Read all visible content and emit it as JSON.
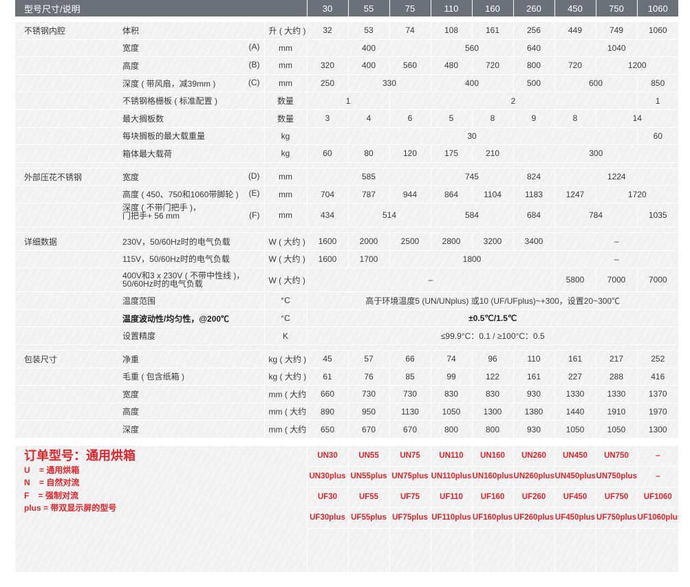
{
  "header": {
    "title": "型号尺寸/说明",
    "models": [
      "30",
      "55",
      "75",
      "110",
      "160",
      "260",
      "450",
      "750",
      "1060"
    ]
  },
  "chamber": {
    "section": "不锈钢内腔",
    "volume": {
      "label": "体积",
      "unit": "升 ( 大约 )",
      "values": [
        "32",
        "53",
        "74",
        "108",
        "161",
        "256",
        "449",
        "749",
        "1060"
      ]
    },
    "width": {
      "label": "宽度",
      "tag": "(A)",
      "unit": "mm",
      "v1": "400",
      "v2": "560",
      "v3": "640",
      "v4": "1040"
    },
    "height": {
      "label": "高度",
      "tag": "(B)",
      "unit": "mm",
      "values": [
        "320",
        "400",
        "560",
        "480",
        "720",
        "800",
        "720"
      ],
      "v8": "1200"
    },
    "depth": {
      "label": "深度 ( 带风扇，减39mm )",
      "tag": "(C)",
      "unit": "mm",
      "v1": "250",
      "v2": "330",
      "v3": "400",
      "v4": "500",
      "v5": "600",
      "v6": "850"
    },
    "grids": {
      "label": "不锈钢格栅板 ( 标准配置 )",
      "unit": "数量",
      "v1": "1",
      "v2": "2",
      "v3": "1"
    },
    "shelves": {
      "label": "最大搁板数",
      "unit": "数量",
      "values": [
        "3",
        "4",
        "6",
        "5",
        "8",
        "9",
        "8"
      ],
      "v8": "14"
    },
    "shelf_load": {
      "label": "每块搁板的最大载重量",
      "unit": "kg",
      "v1": "30",
      "v2": "60"
    },
    "total_load": {
      "label": "箱体最大载荷",
      "unit": "kg",
      "values": [
        "60",
        "80",
        "120",
        "175",
        "210"
      ],
      "v6": "300"
    }
  },
  "exterior": {
    "section": "外部压花不锈钢",
    "width": {
      "label": "宽度",
      "tag": "(D)",
      "unit": "mm",
      "v1": "585",
      "v2": "745",
      "v3": "824",
      "v4": "1224"
    },
    "height": {
      "label": "高度 ( 450、750和1060带脚轮 )",
      "tag": "(E)",
      "unit": "mm",
      "values": [
        "704",
        "787",
        "944",
        "864",
        "1104",
        "1183",
        "1247"
      ],
      "v8": "1720"
    },
    "depth": {
      "label": "深度 ( 不带门把手 )，\n门把手+ 56 mm",
      "tag": "(F)",
      "unit": "mm",
      "v1": "434",
      "v2": "514",
      "v3": "584",
      "v4": "684",
      "v5": "784",
      "v6": "1035"
    }
  },
  "details": {
    "section": "详细数据",
    "load230": {
      "label": "230V，50/60Hz时的电气负载",
      "unit": "W ( 大约 )",
      "values": [
        "1600",
        "2000",
        "2500",
        "2800",
        "3200",
        "3400"
      ],
      "rest": "–"
    },
    "load115": {
      "label": "115V，50/60Hz时的电气负载",
      "unit": "W ( 大约 )",
      "values": [
        "1600",
        "1700"
      ],
      "mid": "1800",
      "rest": "–"
    },
    "load400": {
      "label": "400V和3 x 230V ( 不带中性线 )，\n50/60Hz时的电气负载",
      "unit": "W ( 大约 )",
      "first": "–",
      "values": [
        "5800",
        "7000",
        "7000"
      ]
    },
    "temp_range": {
      "label": "温度范围",
      "unit": "°C",
      "value": "高于环境温度5 (UN/UNplus) 或10 (UF/UFplus)~+300，设置20~300℃"
    },
    "temp_fluct": {
      "label": "温度波动性/均匀性，@200℃",
      "unit": "°C",
      "value": "±0.5℃/1.5℃"
    },
    "accuracy": {
      "label": "设置精度",
      "unit": "K",
      "value": "≤99.9°C：0.1 / ≥100°C：0.5"
    }
  },
  "packing": {
    "section": "包装尺寸",
    "rows": [
      {
        "label": "净重",
        "unit": "kg ( 大约 )",
        "values": [
          "45",
          "57",
          "66",
          "74",
          "96",
          "110",
          "161",
          "217",
          "252"
        ]
      },
      {
        "label": "毛重 ( 包含纸箱 )",
        "unit": "kg ( 大约 )",
        "values": [
          "61",
          "76",
          "85",
          "99",
          "122",
          "161",
          "227",
          "288",
          "416"
        ]
      },
      {
        "label": "宽度",
        "unit": "mm ( 大约 )",
        "values": [
          "660",
          "730",
          "730",
          "830",
          "830",
          "930",
          "1330",
          "1330",
          "1370"
        ]
      },
      {
        "label": "高度",
        "unit": "mm ( 大约 )",
        "values": [
          "890",
          "950",
          "1130",
          "1050",
          "1300",
          "1380",
          "1440",
          "1910",
          "1970"
        ]
      },
      {
        "label": "深度",
        "unit": "mm ( 大约 )",
        "values": [
          "650",
          "670",
          "670",
          "800",
          "800",
          "930",
          "1050",
          "1050",
          "1300"
        ]
      }
    ]
  },
  "order": {
    "title": "订单型号：通用烘箱",
    "legend": [
      "U    = 通用烘箱",
      "N    = 自然对流",
      "F    = 强制对流",
      "plus = 带双显示屏的型号"
    ],
    "rows": [
      [
        "UN30",
        "UN55",
        "UN75",
        "UN110",
        "UN160",
        "UN260",
        "UN450",
        "UN750",
        "–"
      ],
      [
        "UN30plus",
        "UN55plus",
        "UN75plus",
        "UN110plus",
        "UN160plus",
        "UN260plus",
        "UN450plus",
        "UN750plus",
        "–"
      ],
      [
        "UF30",
        "UF55",
        "UF75",
        "UF110",
        "UF160",
        "UF260",
        "UF450",
        "UF750",
        "UF1060"
      ],
      [
        "UF30plus",
        "UF55plus",
        "UF75plus",
        "UF110plus",
        "UF160plus",
        "UF260plus",
        "UF450plus",
        "UF750plus",
        "UF1060plus"
      ]
    ]
  }
}
